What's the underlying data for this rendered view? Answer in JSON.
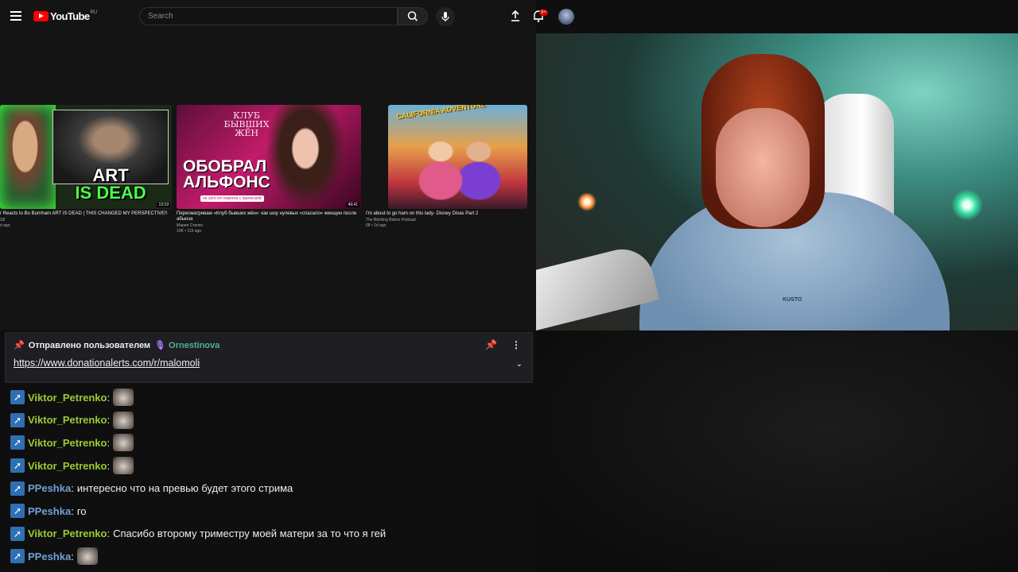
{
  "youtube": {
    "logo_text": "YouTube",
    "logo_region": "RU",
    "search_placeholder": "Search",
    "notification_count": "9+",
    "colors": {
      "brand_red": "#ff0000",
      "background": "#0f0f0f"
    },
    "videos": [
      {
        "title": "r Reacts to Bo Burnham ART IS DEAD | THIS CHANGED MY PERSPECTIVE!!",
        "channel": "S8",
        "meta": "d ago",
        "duration": "13:19",
        "thumb_text_1": "ART",
        "thumb_text_2": "IS DEAD"
      },
      {
        "title": "Пересматриваю «Клуб бывших жён»: как шоу нулевых «спасало» женщин после абьюза",
        "channel": "Мария Степко",
        "meta": "10K • 11h ago",
        "duration": "49:41",
        "thumb_text_1": "КЛУБ БЫВШИХ ЖЁН",
        "thumb_text_2": "ОБОБРАЛ АЛЬФОНС",
        "thumb_text_3": "не зато её помогли с прической"
      },
      {
        "title": "I'm about to go ham on this lady- Disney Divas Part 2",
        "channel": "The Bitching Babes Podcast",
        "meta": "68 • 1d ago",
        "thumb_text_1": "CALIFORNIA ADVENTURE"
      }
    ]
  },
  "webcam": {
    "shirt_logo": "KUSTO"
  },
  "pinned": {
    "header_text": "Отправлено пользователем",
    "user": "Ornestinova",
    "link": "https://www.donationalerts.com/r/malomoli",
    "colors": {
      "user": "#4fb38d",
      "mic": "#b17cff"
    }
  },
  "chat": {
    "messages": [
      {
        "user": "Viktor_Petrenko",
        "text": "",
        "emote": true
      },
      {
        "user": "Viktor_Petrenko",
        "text": "",
        "emote": true
      },
      {
        "user": "Viktor_Petrenko",
        "text": "",
        "emote": true
      },
      {
        "user": "Viktor_Petrenko",
        "text": "",
        "emote": true
      },
      {
        "user": "PPeshka",
        "text": "интересно что на превью будет этого стрима",
        "emote": false
      },
      {
        "user": "PPeshka",
        "text": "го",
        "emote": false
      },
      {
        "user": "Viktor_Petrenko",
        "text": "Спасибо второму триместру моей матери за то что я гей",
        "emote": false
      },
      {
        "user": "PPeshka",
        "text": "",
        "emote": true
      }
    ],
    "colors": {
      "Viktor_Petrenko": "#9acd32",
      "PPeshka": "#6fa1d6",
      "badge": "#2f6fb3"
    }
  }
}
